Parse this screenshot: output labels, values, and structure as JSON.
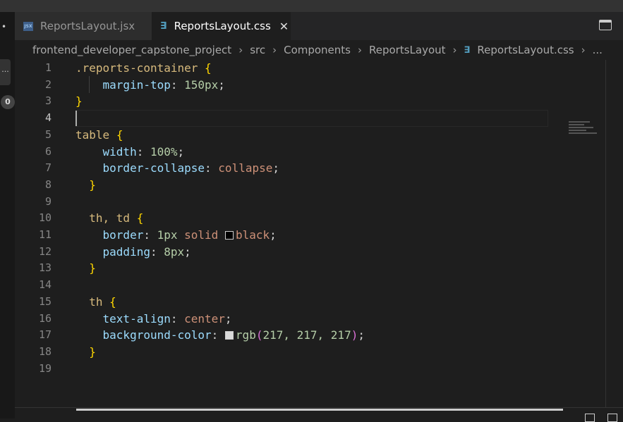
{
  "tabs": [
    {
      "label": "ReportsLayout.jsx",
      "icon": "jsx-file-icon",
      "icon_text": "JSX",
      "active": false
    },
    {
      "label": "ReportsLayout.css",
      "icon": "css-file-icon",
      "active": true
    }
  ],
  "activity": {
    "badge": "0",
    "more": "..."
  },
  "breadcrumb": [
    "frontend_developer_capstone_project",
    "src",
    "Components",
    "ReportsLayout",
    "ReportsLayout.css",
    "..."
  ],
  "editor": {
    "current_line": 4,
    "colors": {
      "selector": "#d7ba7d",
      "property": "#9cdcfe",
      "number": "#b5cea8",
      "value": "#ce9178",
      "brace": "#ffd700",
      "paren": "#da70d6",
      "text": "#d4d4d4"
    },
    "lines": [
      [
        [
          "selector",
          "    "
        ],
        [
          "selector",
          ".reports-container"
        ],
        [
          "text",
          " "
        ],
        [
          "brace",
          "{"
        ]
      ],
      [
        [
          "text",
          "    "
        ],
        [
          "property",
          "margin-top"
        ],
        [
          "text",
          ": "
        ],
        [
          "number",
          "150px"
        ],
        [
          "text",
          ";"
        ]
      ],
      [
        [
          "brace",
          "}"
        ]
      ],
      [],
      [
        [
          "selector",
          "table"
        ],
        [
          "text",
          " "
        ],
        [
          "brace",
          "{"
        ]
      ],
      [
        [
          "text",
          "    "
        ],
        [
          "property",
          "width"
        ],
        [
          "text",
          ": "
        ],
        [
          "number",
          "100%"
        ],
        [
          "text",
          ";"
        ]
      ],
      [
        [
          "text",
          "    "
        ],
        [
          "property",
          "border-collapse"
        ],
        [
          "text",
          ": "
        ],
        [
          "value",
          "collapse"
        ],
        [
          "text",
          ";"
        ]
      ],
      [
        [
          "text",
          "  "
        ],
        [
          "brace",
          "}"
        ]
      ],
      [],
      [
        [
          "text",
          "  "
        ],
        [
          "selector",
          "th, td"
        ],
        [
          "text",
          " "
        ],
        [
          "brace",
          "{"
        ]
      ],
      [
        [
          "text",
          "    "
        ],
        [
          "property",
          "border"
        ],
        [
          "text",
          ": "
        ],
        [
          "number",
          "1px"
        ],
        [
          "text",
          " "
        ],
        [
          "value",
          "solid"
        ],
        [
          "text",
          " "
        ],
        [
          "swatch",
          "#000000"
        ],
        [
          "value",
          "black"
        ],
        [
          "text",
          ";"
        ]
      ],
      [
        [
          "text",
          "    "
        ],
        [
          "property",
          "padding"
        ],
        [
          "text",
          ": "
        ],
        [
          "number",
          "8px"
        ],
        [
          "text",
          ";"
        ]
      ],
      [
        [
          "text",
          "  "
        ],
        [
          "brace",
          "}"
        ]
      ],
      [],
      [
        [
          "text",
          "  "
        ],
        [
          "selector",
          "th"
        ],
        [
          "text",
          " "
        ],
        [
          "brace",
          "{"
        ]
      ],
      [
        [
          "text",
          "    "
        ],
        [
          "property",
          "text-align"
        ],
        [
          "text",
          ": "
        ],
        [
          "value",
          "center"
        ],
        [
          "text",
          ";"
        ]
      ],
      [
        [
          "text",
          "    "
        ],
        [
          "property",
          "background-color"
        ],
        [
          "text",
          ": "
        ],
        [
          "swatch",
          "#d9d9d9"
        ],
        [
          "number",
          "rgb"
        ],
        [
          "paren",
          "("
        ],
        [
          "number",
          "217, 217, 217"
        ],
        [
          "paren",
          ")"
        ],
        [
          "text",
          ";"
        ]
      ],
      [
        [
          "text",
          "  "
        ],
        [
          "brace",
          "}"
        ]
      ],
      []
    ]
  }
}
